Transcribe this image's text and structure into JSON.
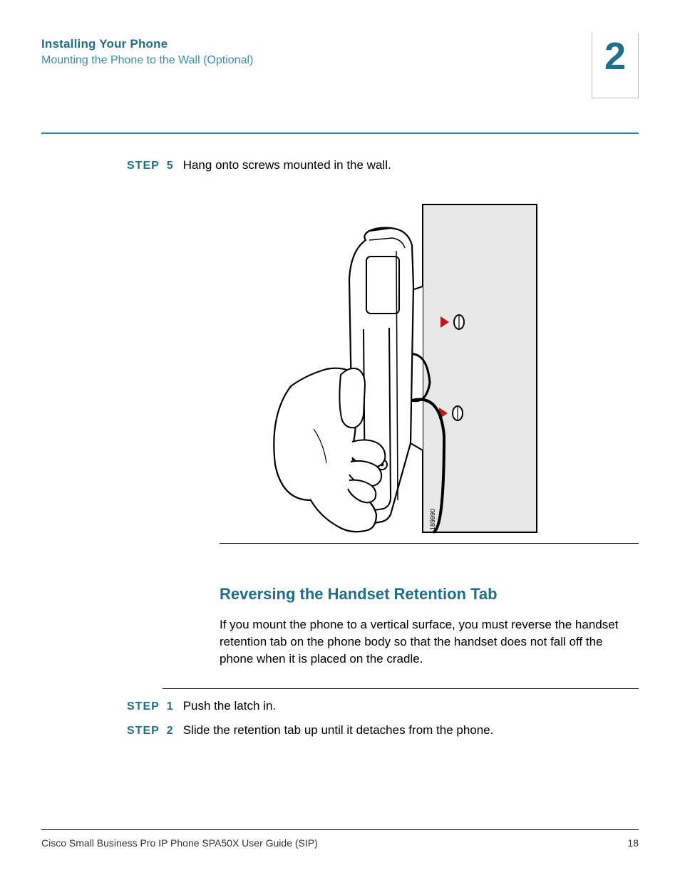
{
  "header": {
    "title": "Installing Your Phone",
    "subtitle": "Mounting the Phone to the Wall (Optional)",
    "chapter": "2"
  },
  "step5": {
    "label": "STEP",
    "num": "5",
    "text": "Hang onto screws mounted in the wall."
  },
  "figure": {
    "caption_id": "189990"
  },
  "section": {
    "heading": "Reversing the Handset Retention Tab",
    "paragraph": "If you mount the phone to a vertical surface, you must reverse the handset retention tab on the phone body so that the handset does not fall off the phone when it is placed on the cradle."
  },
  "steps": [
    {
      "label": "STEP",
      "num": "1",
      "text": "Push the latch in."
    },
    {
      "label": "STEP",
      "num": "2",
      "text": "Slide the retention tab up until it detaches from the phone."
    }
  ],
  "footer": {
    "doc": "Cisco Small Business Pro IP Phone SPA50X User Guide (SIP)",
    "page": "18"
  }
}
